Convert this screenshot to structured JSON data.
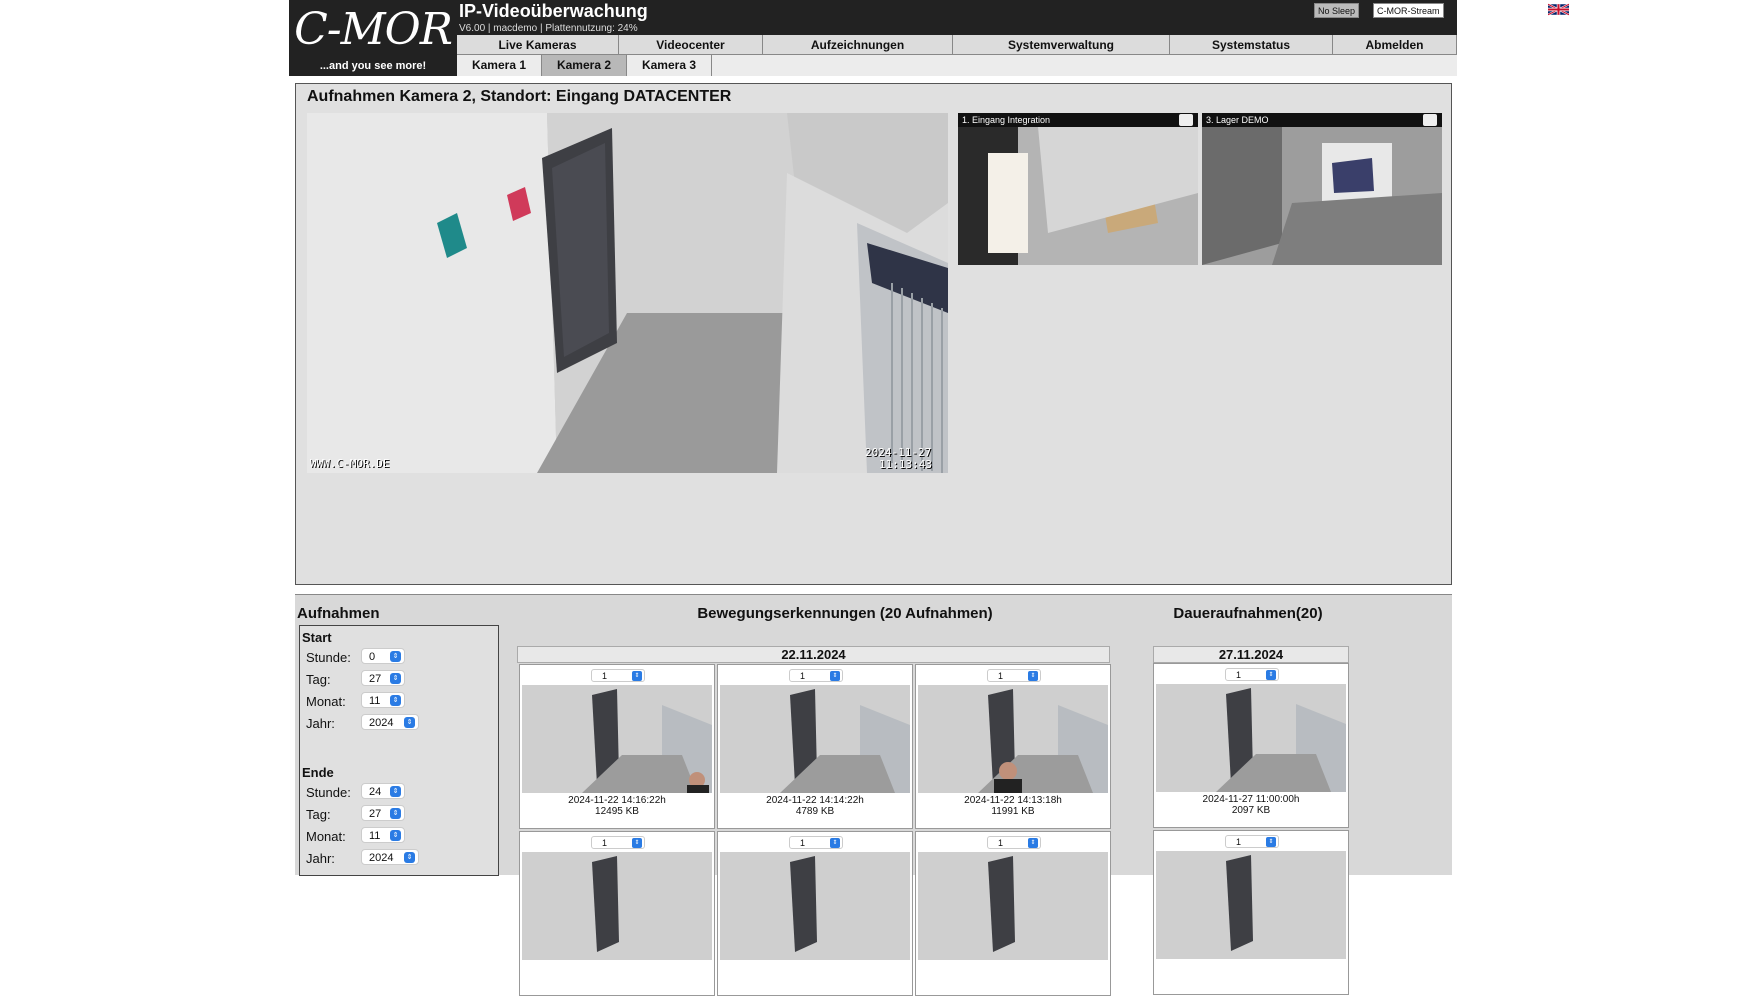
{
  "header": {
    "logo_mark": "C-MOR",
    "logo_tagline": "...and you see more!",
    "title": "IP-Videoüberwachung",
    "subtitle": "V6.00 | macdemo | Plattennutzung: 24%",
    "no_sleep_label": "No Sleep",
    "stream_label": "C-MOR-Stream",
    "flag_icon": "uk-flag-icon"
  },
  "nav": [
    {
      "label": "Live Kameras"
    },
    {
      "label": "Videocenter"
    },
    {
      "label": "Aufzeichnungen"
    },
    {
      "label": "Systemverwaltung"
    },
    {
      "label": "Systemstatus"
    },
    {
      "label": "Abmelden"
    }
  ],
  "subnav": [
    {
      "label": "Kamera 1",
      "active": false
    },
    {
      "label": "Kamera 2",
      "active": true
    },
    {
      "label": "Kamera 3",
      "active": false
    }
  ],
  "viewer": {
    "title": "Aufnahmen Kamera 2, Standort: Eingang DATACENTER",
    "main_watermark": "WWW.C-MOR.DE",
    "main_date": "2024-11-27",
    "main_time": "11:13:43",
    "thumbs": [
      {
        "label": "1. Eingang Integration"
      },
      {
        "label": "3. Lager DEMO"
      }
    ]
  },
  "recordings": {
    "title": "Aufnahmen",
    "start_label": "Start",
    "end_label": "Ende",
    "fields": {
      "stunde": "Stunde:",
      "tag": "Tag:",
      "monat": "Monat:",
      "jahr": "Jahr:"
    },
    "start": {
      "stunde": "0",
      "tag": "27",
      "monat": "11",
      "jahr": "2024"
    },
    "end": {
      "stunde": "24",
      "tag": "27",
      "monat": "11",
      "jahr": "2024"
    },
    "motion_title": "Bewegungserkennungen (20 Aufnahmen)",
    "motion_date": "22.11.2024",
    "motion_cards": [
      {
        "select": "1",
        "time": "2024-11-22 14:16:22h",
        "size": "12495 KB"
      },
      {
        "select": "1",
        "time": "2024-11-22 14:14:22h",
        "size": "4789 KB"
      },
      {
        "select": "1",
        "time": "2024-11-22 14:13:18h",
        "size": "11991 KB"
      },
      {
        "select": "1"
      },
      {
        "select": "1"
      },
      {
        "select": "1"
      }
    ],
    "permanent_title": "Daueraufnahmen(20)",
    "permanent_date": "27.11.2024",
    "permanent_cards": [
      {
        "select": "1",
        "time": "2024-11-27 11:00:00h",
        "size": "2097 KB"
      },
      {
        "select": "1"
      }
    ]
  }
}
